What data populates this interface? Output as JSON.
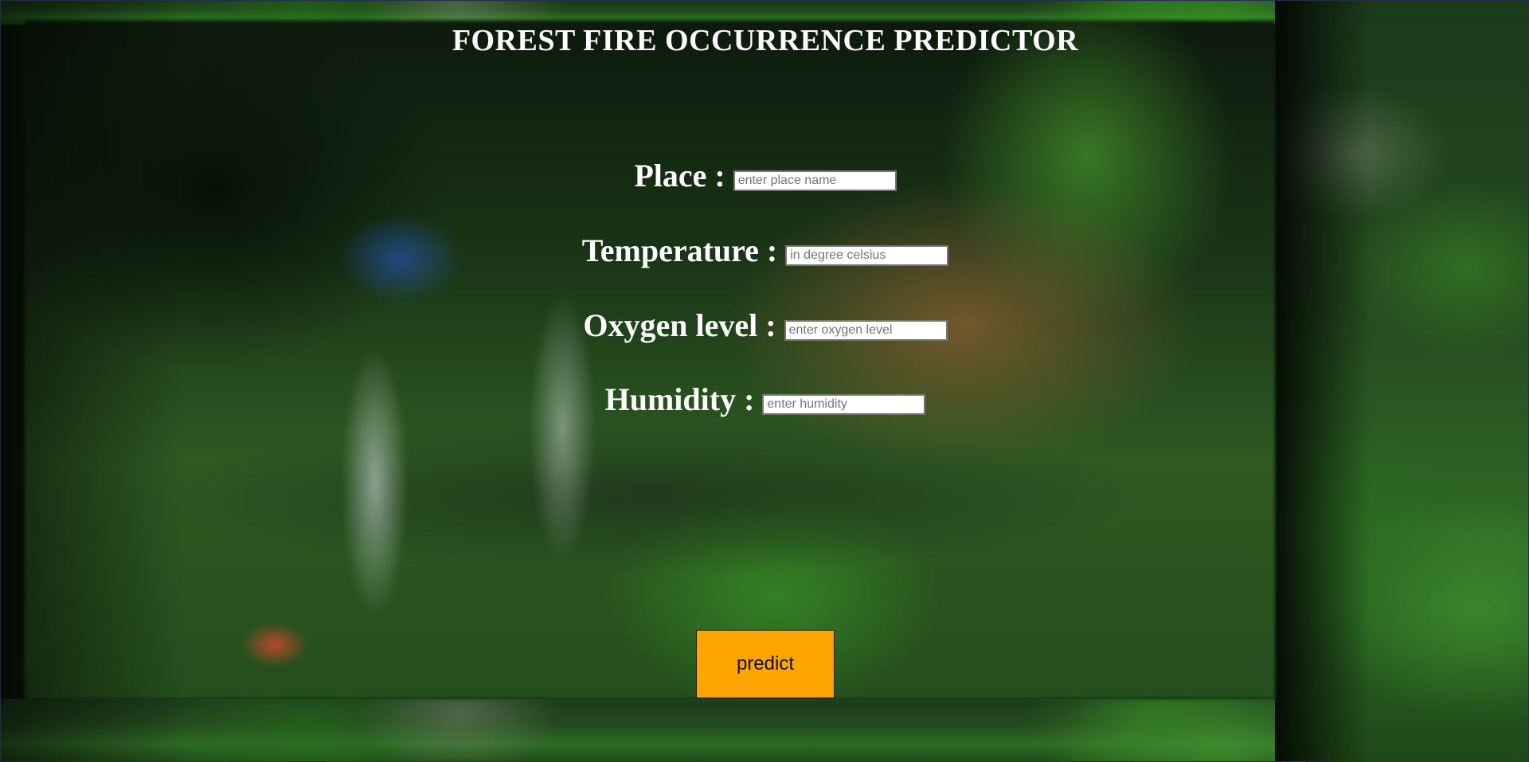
{
  "page": {
    "title": "FOREST FIRE OCCURRENCE PREDICTOR"
  },
  "form": {
    "fields": [
      {
        "label": "Place :",
        "placeholder": "enter place name",
        "value": ""
      },
      {
        "label": "Temperature :",
        "placeholder": "in degree celsius",
        "value": ""
      },
      {
        "label": "Oxygen level :",
        "placeholder": "enter oxygen level",
        "value": ""
      },
      {
        "label": "Humidity :",
        "placeholder": "enter humidity",
        "value": ""
      }
    ],
    "submit_label": "predict"
  },
  "colors": {
    "button_background": "#ffa500",
    "text": "#ffffff"
  }
}
